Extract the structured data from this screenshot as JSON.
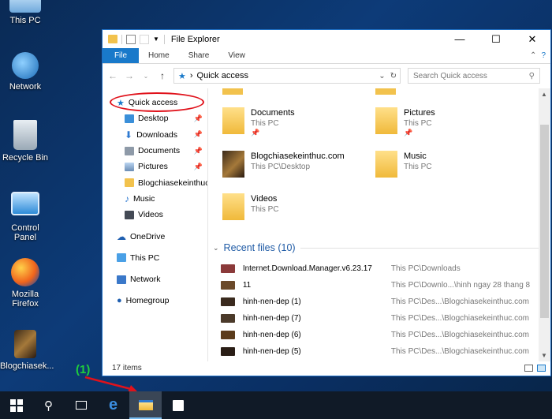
{
  "desktop": {
    "icons": [
      {
        "label": "This PC"
      },
      {
        "label": "Network"
      },
      {
        "label": "Recycle Bin"
      },
      {
        "label": "Control Panel"
      },
      {
        "label": "Mozilla Firefox"
      },
      {
        "label": "Blogchiasek..."
      }
    ]
  },
  "window": {
    "title": "File Explorer",
    "controls": {
      "minimize": "—",
      "maximize": "☐",
      "close": "✕"
    },
    "ribbon_tabs": [
      "File",
      "Home",
      "Share",
      "View"
    ],
    "ribbon_tools": {
      "collapse": "⌃",
      "help": "?"
    },
    "address": {
      "separator": "›",
      "path": "Quick access"
    },
    "search_placeholder": "Search Quick access",
    "status": "17 items"
  },
  "nav": {
    "quick_access": "Quick access",
    "pinned": [
      {
        "label": "Desktop",
        "color": "#3a8fd9"
      },
      {
        "label": "Downloads",
        "color": "#2f7ad1"
      },
      {
        "label": "Documents",
        "color": "#8e9aa8"
      },
      {
        "label": "Pictures",
        "color": "#6a8cb5"
      },
      {
        "label": "Blogchiasekeinthuc",
        "color": "#f2c24d"
      },
      {
        "label": "Music",
        "color": "#2f7ad1"
      },
      {
        "label": "Videos",
        "color": "#444a55"
      }
    ],
    "onedrive": "OneDrive",
    "thispc": "This PC",
    "network": "Network",
    "homegroup": "Homegroup"
  },
  "folders": [
    {
      "name": "Documents",
      "loc": "This PC"
    },
    {
      "name": "Pictures",
      "loc": "This PC"
    },
    {
      "name": "Blogchiasekeinthuc.com",
      "loc": "This PC\\Desktop"
    },
    {
      "name": "Music",
      "loc": "This PC"
    },
    {
      "name": "Videos",
      "loc": "This PC"
    }
  ],
  "recent": {
    "header": "Recent files (10)",
    "rows": [
      {
        "name": "Internet.Download.Manager.v6.23.17",
        "path": "This PC\\Downloads",
        "color": "#8b3a3a"
      },
      {
        "name": "11",
        "path": "This PC\\Downlo...\\hinh ngay 28 thang 8",
        "color": "#6b4a2a"
      },
      {
        "name": "hinh-nen-dep (1)",
        "path": "This PC\\Des...\\Blogchiasekeinthuc.com",
        "color": "#3a2a1e"
      },
      {
        "name": "hinh-nen-dep (7)",
        "path": "This PC\\Des...\\Blogchiasekeinthuc.com",
        "color": "#4b3a2a"
      },
      {
        "name": "hinh-nen-dep (6)",
        "path": "This PC\\Des...\\Blogchiasekeinthuc.com",
        "color": "#5b3b1b"
      },
      {
        "name": "hinh-nen-dep (5)",
        "path": "This PC\\Des...\\Blogchiasekeinthuc.com",
        "color": "#2a1e16"
      }
    ]
  },
  "annotation": {
    "label": "(1)"
  },
  "colors": {
    "accent": "#1979ca",
    "highlight": "#e0121b",
    "annotation": "#1fce3c"
  }
}
